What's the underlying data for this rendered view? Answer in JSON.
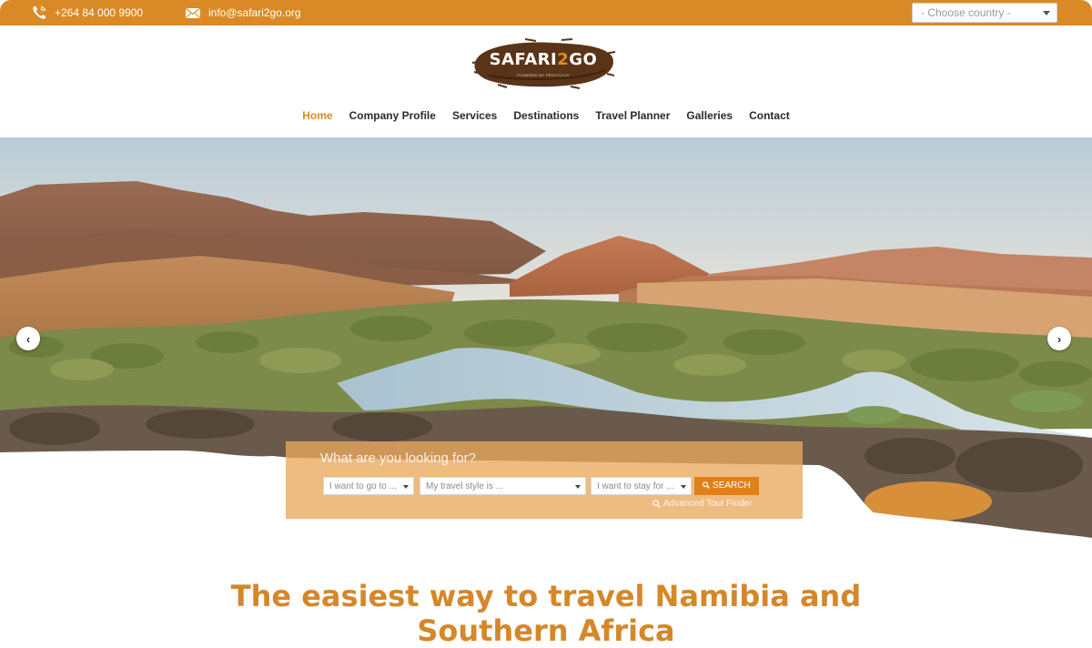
{
  "topbar": {
    "phone": "+264 84 000 9900",
    "email": "info@safari2go.org",
    "country_select": "- Choose country -",
    "icons": {
      "phone": "phone-icon",
      "email": "envelope-icon"
    }
  },
  "logo": {
    "text_main": "SAFARI",
    "text_num": "2",
    "text_end": "GO",
    "subtitle": "POWERED BY PROCYCLIS"
  },
  "nav": {
    "items": [
      {
        "label": "Home",
        "active": true
      },
      {
        "label": "Company Profile"
      },
      {
        "label": "Services"
      },
      {
        "label": "Destinations"
      },
      {
        "label": "Travel Planner"
      },
      {
        "label": "Galleries"
      },
      {
        "label": "Contact"
      }
    ]
  },
  "hero": {
    "prev_glyph": "‹",
    "next_glyph": "›"
  },
  "search": {
    "title": "What are you looking for?",
    "go_to": "I want to go to ...",
    "travel_style": "My travel style is ...",
    "stay_for": "I want to stay for ...",
    "button": "SEARCH",
    "advanced": "Advanced Tour Finder"
  },
  "headline": {
    "line1": "The easiest way to travel Namibia and",
    "line2": "Southern Africa"
  },
  "colors": {
    "accent": "#d98a26",
    "headline": "#d4882a",
    "button": "#e0801a"
  }
}
